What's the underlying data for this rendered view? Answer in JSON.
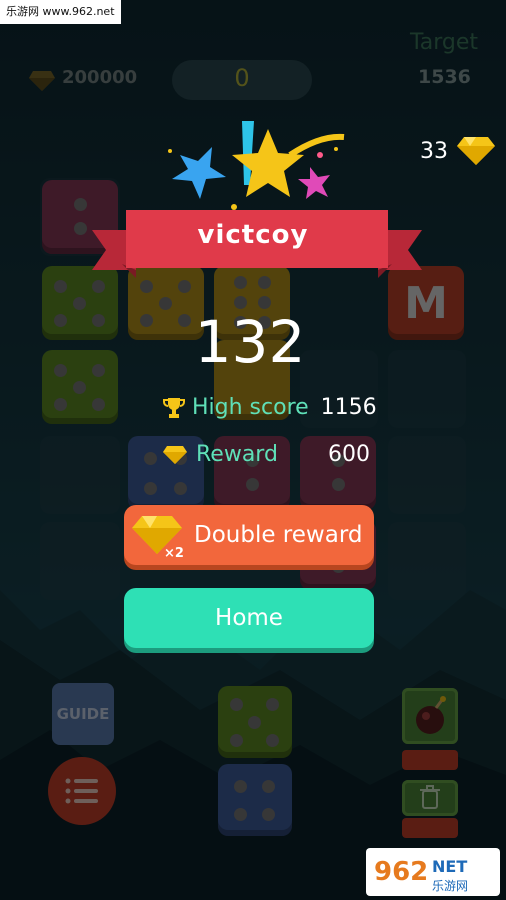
{
  "watermark": {
    "site": "乐游网 www.962.net"
  },
  "header": {
    "gem_count": "200000",
    "current_score": "0",
    "target_label": "Target",
    "target_value": "1536"
  },
  "side_gems": {
    "count": "33"
  },
  "board": {
    "tiles": [
      {
        "kind": "dice",
        "value": 2,
        "color": "#8a3a5a"
      },
      {
        "kind": "dice",
        "value": 5,
        "color": "#5f8f24"
      },
      {
        "kind": "dice",
        "value": 5,
        "color": "#b8941c"
      },
      {
        "kind": "dice",
        "value": 6,
        "color": "#b8941c"
      },
      {
        "kind": "letter",
        "value": "M",
        "color": "#c0442a"
      },
      {
        "kind": "dice",
        "value": 5,
        "color": "#5f8f24"
      },
      {
        "kind": "dice",
        "value": 4,
        "color": "#3f5fa0"
      },
      {
        "kind": "dice",
        "value": 2,
        "color": "#8a3a5a"
      },
      {
        "kind": "dice",
        "value": 2,
        "color": "#8a3a5a"
      }
    ]
  },
  "result": {
    "title": "victcoy",
    "score": "132",
    "high_score_label": "High score",
    "high_score": "1156",
    "reward_label": "Reward",
    "reward": "600",
    "double_reward_label": "Double reward",
    "double_badge": "×2",
    "home_label": "Home"
  },
  "tools": {
    "guide_label": "GUIDE",
    "next_dice": [
      {
        "value": 5,
        "color": "#5f8f24"
      },
      {
        "value": 4,
        "color": "#3f5fa0"
      }
    ]
  },
  "logo": {
    "number": "962",
    "suffix": "NET",
    "sub": "乐游网"
  },
  "colors": {
    "accent_teal": "#2ee0b5",
    "accent_orange": "#f2673c",
    "ribbon_red": "#e03a4a",
    "gem_yellow": "#f5c518"
  },
  "icons": [
    "diamond-icon",
    "trophy-icon",
    "star-icon",
    "menu-icon",
    "trash-icon",
    "bomb-icon"
  ]
}
